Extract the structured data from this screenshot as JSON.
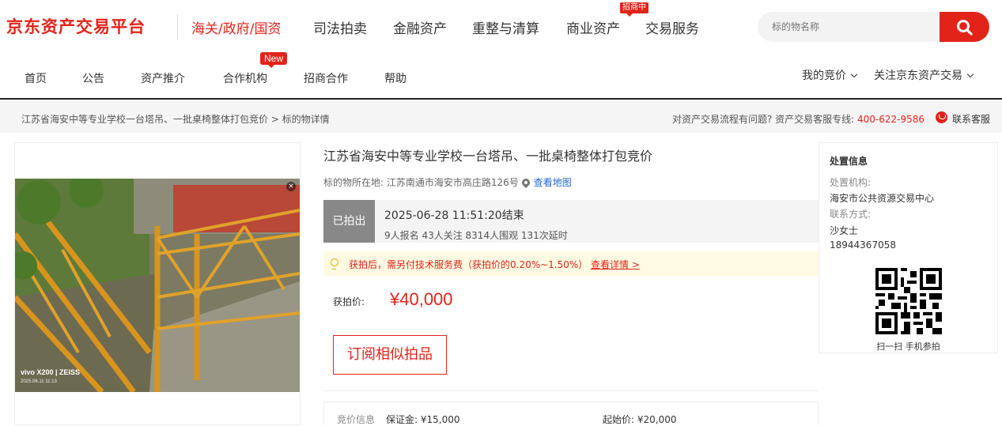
{
  "header": {
    "logo": "京东资产交易平台",
    "categories": [
      "海关/政府/国资",
      "司法拍卖",
      "金融资产",
      "重整与清算",
      "商业资产",
      "交易服务"
    ],
    "recruit_badge": "招商中",
    "search_placeholder": "标的物名称"
  },
  "subnav": {
    "items": [
      "首页",
      "公告",
      "资产推介",
      "合作机构",
      "招商合作",
      "帮助"
    ],
    "new_badge": "New",
    "my_bids": "我的竞价",
    "follow": "关注京东资产交易"
  },
  "breadcrumb": {
    "path": "江苏省海安中等专业学校一台塔吊、一批桌椅整体打包竞价 > 标的物详情",
    "help": "对资产交易流程有问题? 资产交易客服专线: ",
    "phone": "400-622-9586",
    "service": "联系客服"
  },
  "photo": {
    "watermark": "vivo X200 | ZEISS",
    "watermark_date": "2025.06.11 11:13"
  },
  "item": {
    "title": "江苏省海安中等专业学校一台塔吊、一批桌椅整体打包竞价",
    "location_label": "标的物所在地:",
    "location": "江苏南通市海安市高庄路126号",
    "map_link": "查看地图",
    "status": "已拍出",
    "end_time": "2025-06-28 11:51:20结束",
    "stats": "9人报名 43人关注 8314人围观 131次延时",
    "notice": "获拍后，需另付技术服务费（获拍价的0.20%~1.50%）",
    "notice_link": "查看详情 >",
    "price_label": "获拍价:",
    "price": "¥40,000",
    "subscribe": "订阅相似拍品",
    "bid_info_label": "竞价信息",
    "deposit": "保证金: ¥15,000",
    "start_price": "起始价: ¥20,000"
  },
  "disposal": {
    "title": "处置信息",
    "org_label": "处置机构:",
    "org": "海安市公共资源交易中心",
    "contact_label": "联系方式:",
    "contact_name": "沙女士",
    "contact_phone": "18944367058",
    "qr_caption": "扫一扫 手机参拍"
  }
}
